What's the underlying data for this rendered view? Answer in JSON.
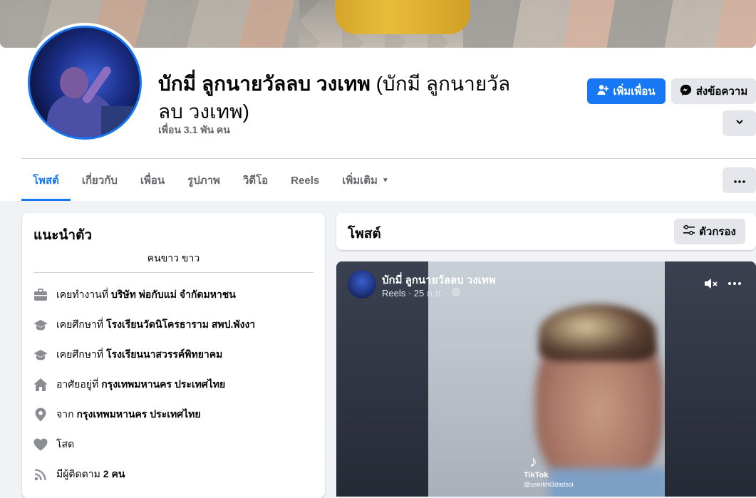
{
  "profile": {
    "name": "บักมี่ ลูกนายวัลลบ วงเทพ",
    "alt_name_line1": "(บักมี ลูกนายวัล",
    "alt_name_line2": "ลบ วงเทพ)",
    "friends": "เพื่อน 3.1 พัน คน"
  },
  "actions": {
    "add_friend": "เพิ่มเพื่อน",
    "message": "ส่งข้อความ"
  },
  "tabs": [
    {
      "label": "โพสต์",
      "active": true
    },
    {
      "label": "เกี่ยวกับ"
    },
    {
      "label": "เพื่อน"
    },
    {
      "label": "รูปภาพ"
    },
    {
      "label": "วิดีโอ"
    },
    {
      "label": "Reels"
    },
    {
      "label": "เพิ่มเติม"
    }
  ],
  "intro": {
    "title": "แนะนำตัว",
    "bio": "คนขาว ขาว",
    "items": [
      {
        "icon": "briefcase-icon",
        "prefix": "เคยทำงานที่",
        "value": "บริษัท พ่อกับแม่ จำกัดมหาชน"
      },
      {
        "icon": "graduation-cap-icon",
        "prefix": "เคยศึกษาที่",
        "value": "โรงเรียนวัดนิโครธาราม สพป.พังงา"
      },
      {
        "icon": "graduation-cap-icon",
        "prefix": "เคยศึกษาที่",
        "value": "โรงเรียนนาสวรรค์พิทยาคม"
      },
      {
        "icon": "home-icon",
        "prefix": "อาศัยอยู่ที่",
        "value": "กรุงเทพมหานคร ประเทศไทย"
      },
      {
        "icon": "location-pin-icon",
        "prefix": "จาก",
        "value": "กรุงเทพมหานคร ประเทศไทย"
      },
      {
        "icon": "heart-icon",
        "prefix": "โสด",
        "value": ""
      },
      {
        "icon": "rss-icon",
        "prefix": "มีผู้ติดตาม",
        "value": "2 คน"
      }
    ]
  },
  "posts": {
    "title": "โพสต์",
    "filter_label": "ตัวกรอง"
  },
  "reel": {
    "author": "บักมี่ ลูกนายวัลลบ วงเทพ",
    "meta": "Reels · 25 ก.ย. ·",
    "watermark_brand": "TikTok",
    "watermark_user": "@userkhi3dadsoi"
  },
  "colors": {
    "accent": "#1877f2",
    "page_bg": "#f0f2f5",
    "secondary_btn": "#e4e6eb"
  }
}
